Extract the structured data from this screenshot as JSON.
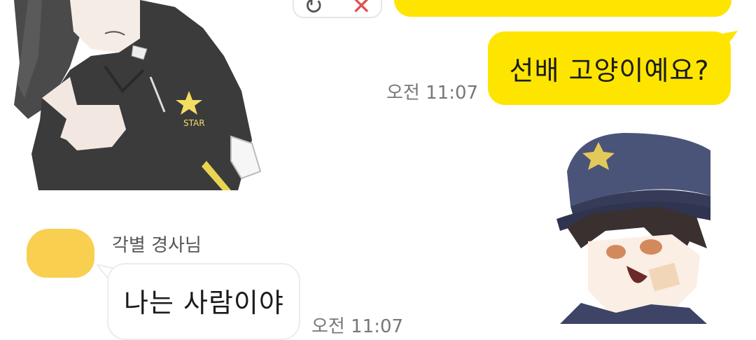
{
  "colors": {
    "my_bubble": "#fee500",
    "other_bubble": "#ffffff",
    "avatar": "#f9cf4f",
    "timestamp": "#777777",
    "resend_icon": "#555555",
    "cancel_icon": "#e05050"
  },
  "reaction_pill": {
    "resend_icon": "↻",
    "cancel_icon": "✕"
  },
  "messages": {
    "mine": {
      "text": "선배 고양이예요?",
      "time": "오전 11:07"
    },
    "theirs": {
      "sender": "각별 경사님",
      "text": "나는 사람이야",
      "time": "오전 11:07"
    }
  },
  "stickers": {
    "left_character_star_text": "STAR"
  }
}
